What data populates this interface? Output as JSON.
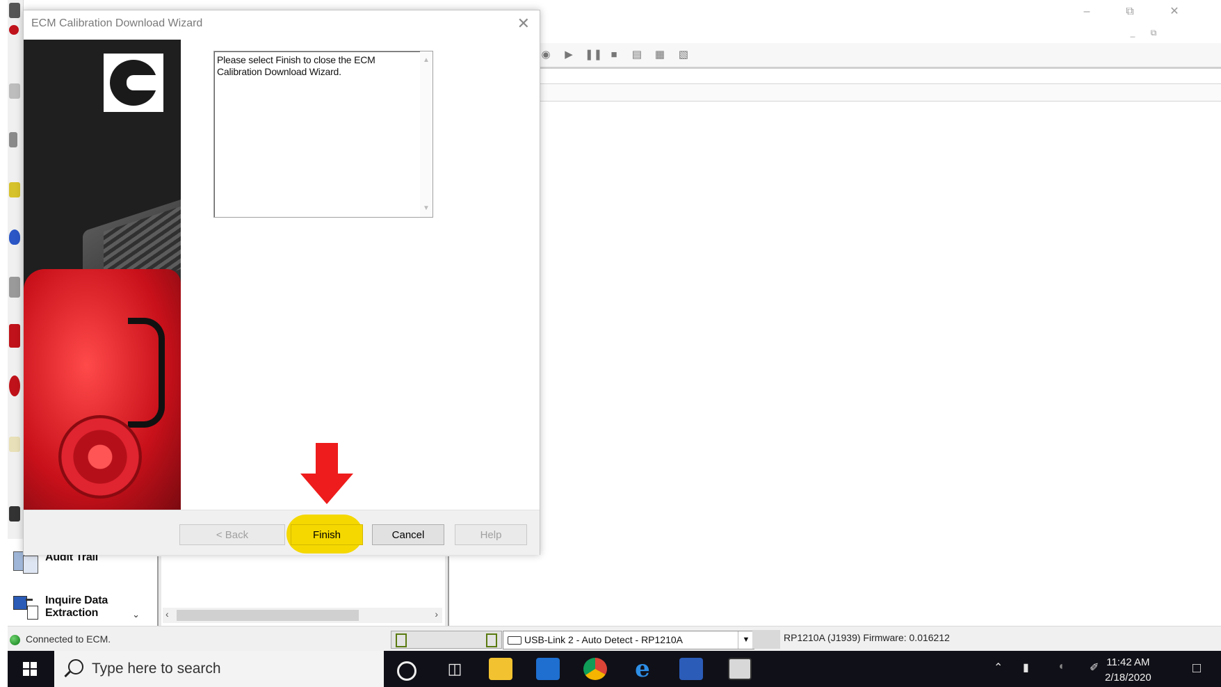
{
  "dialog": {
    "title": "ECM Calibration Download Wizard",
    "message": "Please select Finish to close the ECM Calibration Download Wizard.",
    "buttons": {
      "back": "< Back",
      "finish": "Finish",
      "cancel": "Cancel",
      "help": "Help"
    },
    "highlight_color": "#f5d800",
    "arrow_color": "#ee1c1c"
  },
  "left_nav": {
    "items": [
      {
        "label": "Audit  Trail"
      },
      {
        "label_line1": "Inquire Data",
        "label_line2": "Extraction"
      }
    ]
  },
  "status_bar": {
    "connection_text": "Connected to ECM.",
    "adapter_value": "USB-Link 2 - Auto Detect - RP1210A",
    "firmware_text": "RP1210A (J1939)  Firmware: 0.016212"
  },
  "taskbar": {
    "search_placeholder": "Type here to search",
    "time": "11:42 AM",
    "date": "2/18/2020"
  }
}
